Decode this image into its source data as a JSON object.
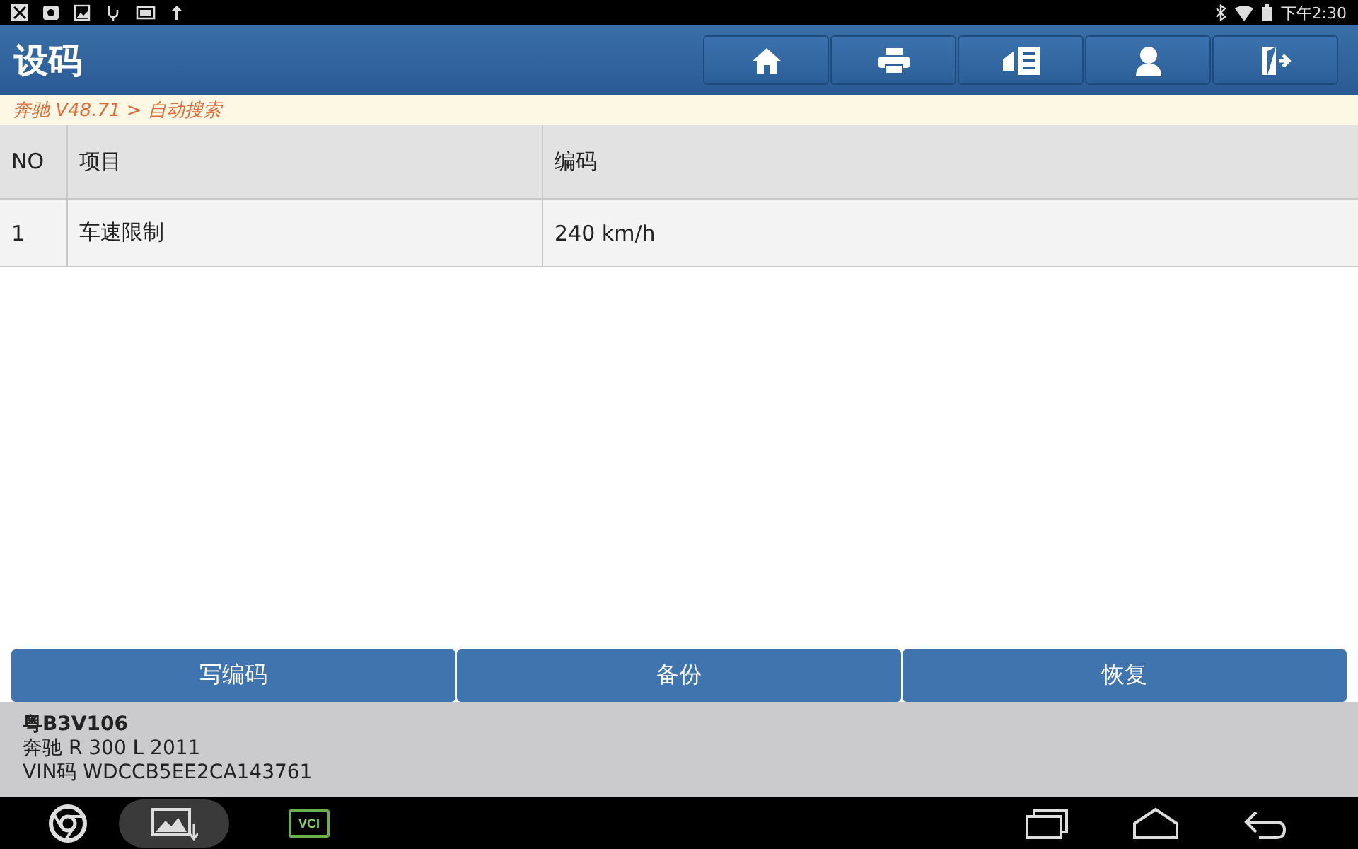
{
  "status_bar": {
    "time": "下午2:30"
  },
  "header": {
    "title": "设码"
  },
  "breadcrumb": "奔驰 V48.71 > 自动搜索",
  "table": {
    "columns": [
      "NO",
      "项目",
      "编码"
    ],
    "rows": [
      [
        "1",
        "车速限制",
        "240 km/h"
      ]
    ]
  },
  "buttons": [
    "写编码",
    "备份",
    "恢复"
  ],
  "vehicle": {
    "plate": "粤B3V106",
    "model": "奔驰 R 300 L 2011",
    "vin": "VIN码 WDCCB5EE2CA143761"
  },
  "taskbar": {
    "vci_label": "VCI"
  }
}
